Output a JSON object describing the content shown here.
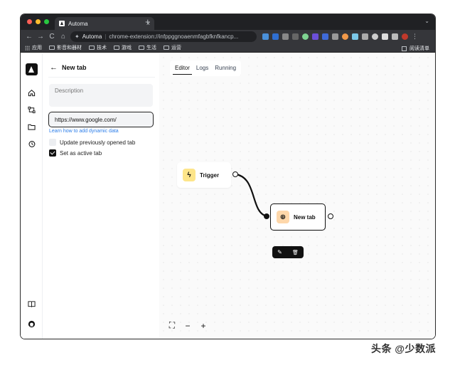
{
  "browser": {
    "tab_title": "Automa",
    "tab_close": "×",
    "new_tab": "+",
    "omnibox_site": "Automa",
    "omnibox_url": "chrome-extension://infppggnoaenmfagbfknfkancp...",
    "nav": {
      "back": "←",
      "forward": "→",
      "reload": "C",
      "home": "⌂"
    },
    "colors": {
      "close": "#ff5f57",
      "minimize": "#febc2e",
      "maximize": "#28c840"
    }
  },
  "bookmarks": {
    "items": [
      "应用",
      "影音和器材",
      "技术",
      "游戏",
      "生活",
      "运营"
    ],
    "reading_list": "阅读清单"
  },
  "rail": {
    "icons": [
      "home-icon",
      "workflow-icon",
      "folder-icon",
      "history-icon",
      "docs-icon",
      "github-icon"
    ]
  },
  "panel": {
    "back_arrow": "←",
    "title": "New tab",
    "description_placeholder": "Description",
    "url_value": "https://www.google.com/",
    "learn_link": "Learn how to add dynamic data",
    "update_label": "Update previously opened tab",
    "active_label": "Set as active tab",
    "update_checked": false,
    "active_checked": true
  },
  "canvas": {
    "tabs": [
      "Editor",
      "Logs",
      "Running"
    ],
    "active_tab": "Editor",
    "trigger_node": {
      "label": "Trigger",
      "icon": "ϟ"
    },
    "newtab_node": {
      "label": "New tab",
      "icon": "⊕"
    },
    "toolbar": {
      "edit": "✎",
      "delete": "🗑"
    },
    "controls": {
      "fit": "⛶",
      "zoom_out": "−",
      "zoom_in": "+"
    },
    "colors": {
      "trigger_icon_bg": "#fde58a",
      "newtab_icon_bg": "#fed7aa"
    }
  },
  "watermark": "头条 @少数派"
}
